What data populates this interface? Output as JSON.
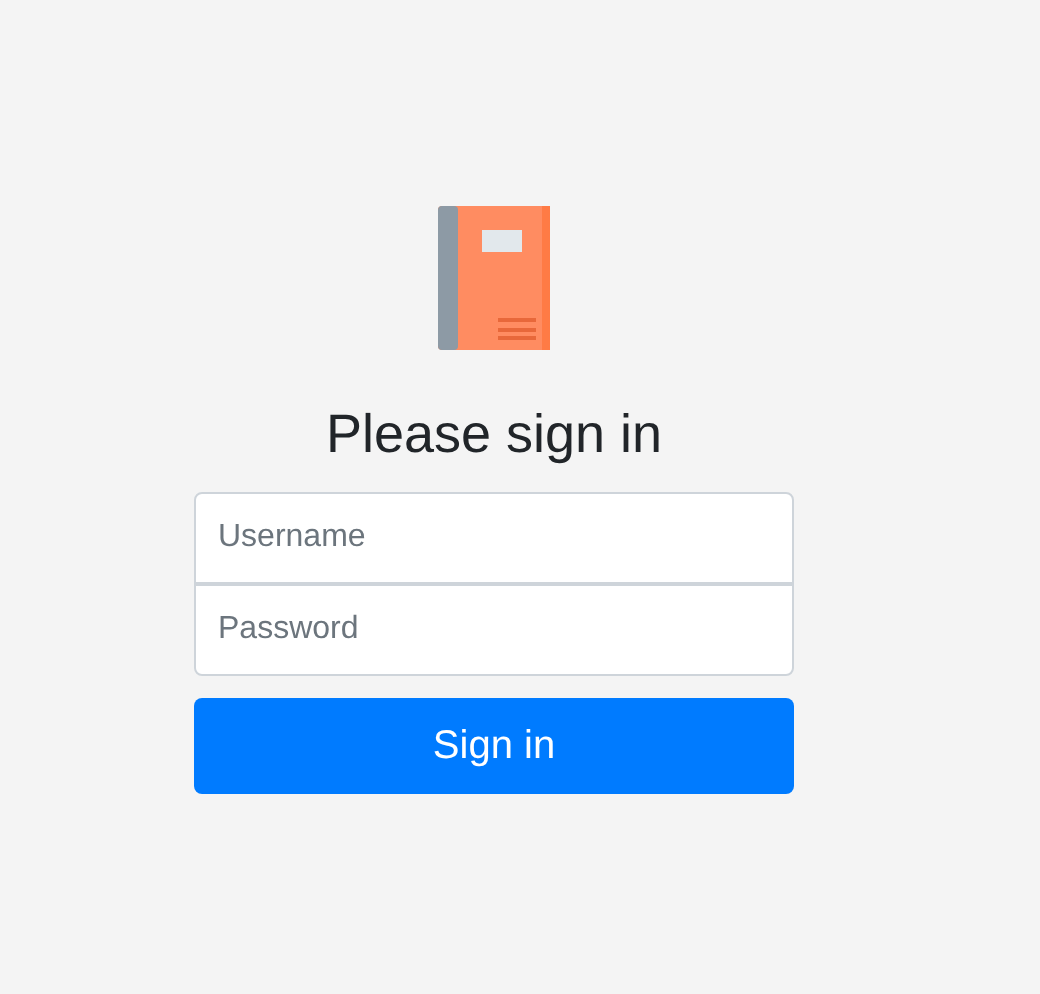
{
  "heading": "Please sign in",
  "fields": [
    {
      "placeholder": "Username"
    },
    {
      "placeholder": "Password"
    }
  ],
  "button": "Sign in"
}
